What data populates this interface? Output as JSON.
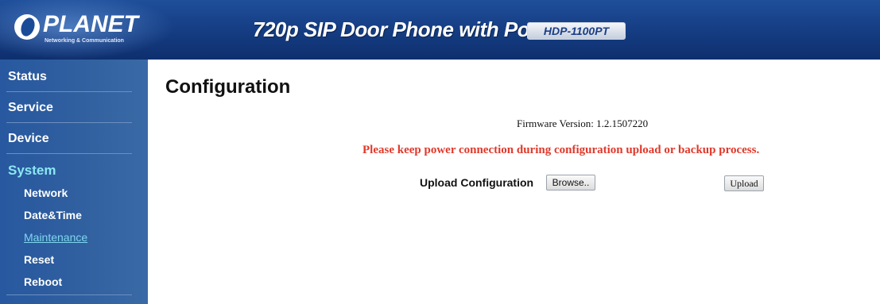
{
  "header": {
    "brand": "PLANET",
    "tagline": "Networking & Communication",
    "product_title": "720p SIP Door Phone with PoE",
    "model": "HDP-1100PT"
  },
  "sidebar": {
    "items": [
      {
        "label": "Status"
      },
      {
        "label": "Service"
      },
      {
        "label": "Device"
      },
      {
        "label": "System",
        "active": true
      }
    ],
    "subitems": [
      {
        "label": "Network"
      },
      {
        "label": "Date&Time"
      },
      {
        "label": "Maintenance",
        "current": true
      },
      {
        "label": "Reset"
      },
      {
        "label": "Reboot"
      }
    ]
  },
  "main": {
    "title": "Configuration",
    "firmware_text": "Firmware Version: 1.2.1507220",
    "warning": "Please keep power connection during configuration upload or backup process.",
    "upload_label": "Upload Configuration",
    "browse_label": "Browse..",
    "upload_button": "Upload"
  },
  "colors": {
    "banner": "#163f86",
    "sidebar": "#30609f",
    "active_nav": "#8be7f2",
    "warning": "#e0392b"
  }
}
